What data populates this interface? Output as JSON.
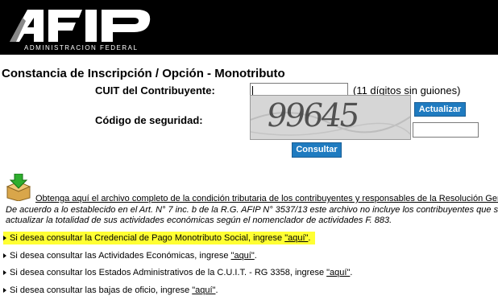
{
  "header": {
    "logo_text": "AFIP",
    "subtitle": "ADMINISTRACION FEDERAL"
  },
  "page": {
    "title": "Constancia de Inscripción / Opción - Monotributo"
  },
  "form": {
    "cuit_label": "CUIT del Contribuyente:",
    "cuit_value": "",
    "cuit_hint": "(11 dígitos sin guiones)",
    "captcha_text": "99645",
    "refresh_button": "Actualizar",
    "security_label": "Código de seguridad:",
    "security_value": "",
    "submit_button": "Consultar"
  },
  "download": {
    "icon": "download-box-icon",
    "link_text": "Obtenga aquí el archivo completo de la condición tributaria de los contribuyentes y responsables de la Resolución Gen",
    "note_line1": "De acuerdo a lo establecido en el Art. N° 7 inc. b de la R.G. AFIP N° 3537/13 este archivo no incluye los contribuyentes que s",
    "note_line2": "actualizar la totalidad de sus actividades económicas según el nomenclador de actividades F. 883."
  },
  "links": [
    {
      "text": "Si desea consultar la Credencial de Pago Monotributo Social, ingrese ",
      "link": "\"aquí\"",
      "suffix": ".",
      "highlighted": true
    },
    {
      "text": "Si desea consultar las Actividades Económicas, ingrese ",
      "link": "\"aquí\"",
      "suffix": ".",
      "highlighted": false
    },
    {
      "text": "Si desea consultar los Estados Administrativos de la C.U.I.T. - RG 3358, ingrese ",
      "link": "\"aquí\"",
      "suffix": ".",
      "highlighted": false
    },
    {
      "text": "Si desea consultar las bajas de oficio, ingrese ",
      "link": "\"aquí\"",
      "suffix": ".",
      "highlighted": false
    }
  ],
  "colors": {
    "header_bg": "#000000",
    "button_bg": "#1f7bc0",
    "highlight": "#ffff33"
  }
}
